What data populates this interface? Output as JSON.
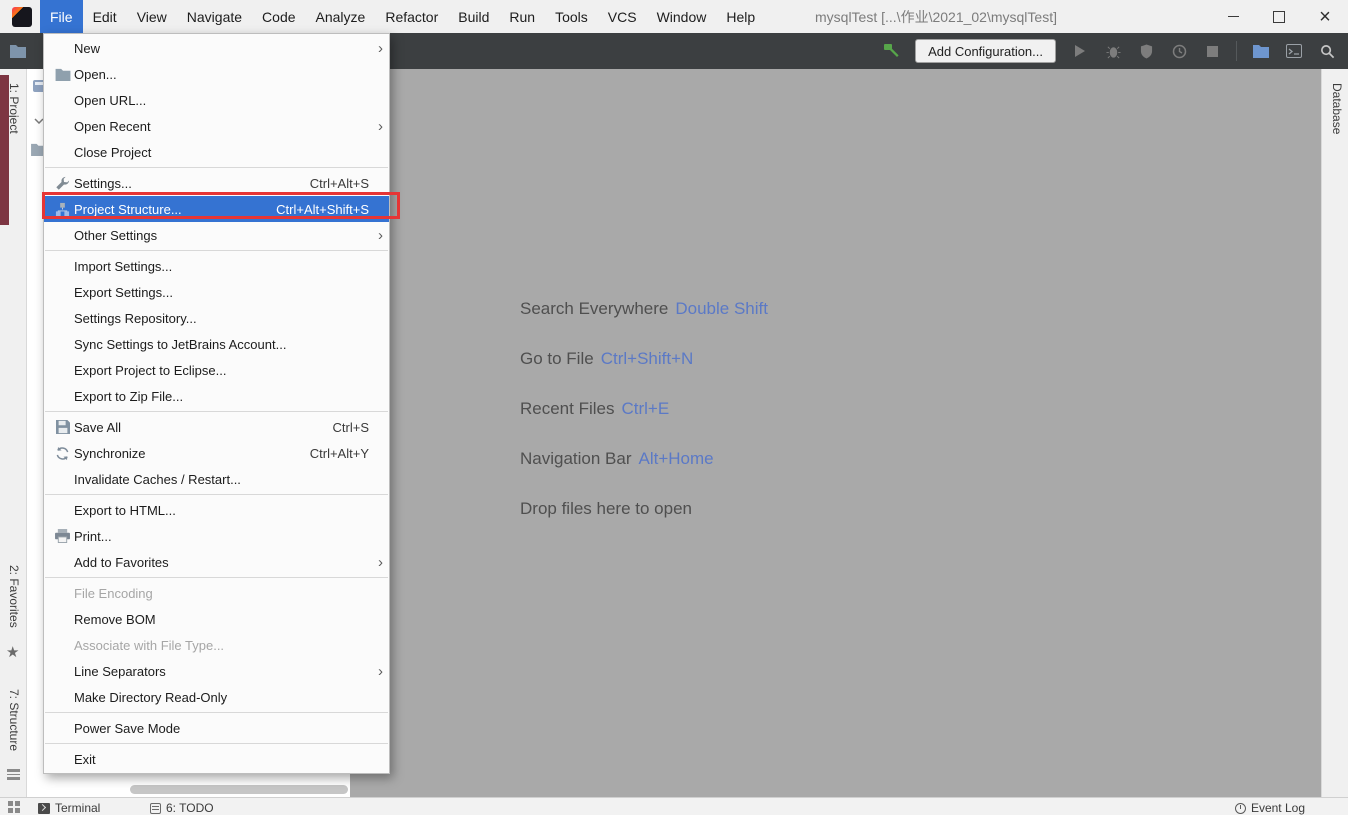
{
  "colors": {
    "titlebar-bg": "#f0f0f0",
    "toolbar-bg": "#3c3f41",
    "main-bg": "#a9a9a9",
    "menu-bg": "#fbfbfb",
    "stripe-bg": "#f0f0f0",
    "panel-bg": "#ffffff",
    "statusbar-bg": "#f2f2f2",
    "selection-blue": "#3573d2",
    "annotation-red": "#e63535",
    "hint-label": "#4f4f4f",
    "hint-shortcut": "#5b79c6",
    "maroon-accent": "#7d3542"
  },
  "titlebar": {
    "title": "mysqlTest [...\\作业\\2021_02\\mysqlTest]"
  },
  "menubar": {
    "items": [
      "File",
      "Edit",
      "View",
      "Navigate",
      "Code",
      "Analyze",
      "Refactor",
      "Build",
      "Run",
      "Tools",
      "VCS",
      "Window",
      "Help"
    ],
    "active": "File"
  },
  "toolbar": {
    "add_configuration_label": "Add Configuration..."
  },
  "stripes": {
    "left": [
      "1: Project",
      "2: Favorites",
      "7: Structure"
    ],
    "right": [
      "Database"
    ]
  },
  "hints": [
    {
      "label": "Search Everywhere",
      "shortcut": "Double Shift"
    },
    {
      "label": "Go to File",
      "shortcut": "Ctrl+Shift+N"
    },
    {
      "label": "Recent Files",
      "shortcut": "Ctrl+E"
    },
    {
      "label": "Navigation Bar",
      "shortcut": "Alt+Home"
    },
    {
      "label": "Drop files here to open",
      "shortcut": ""
    }
  ],
  "file_menu": {
    "items": [
      {
        "label": "New",
        "shortcut": "",
        "submenu": true
      },
      {
        "label": "Open...",
        "shortcut": ""
      },
      {
        "label": "Open URL...",
        "shortcut": ""
      },
      {
        "label": "Open Recent",
        "shortcut": "",
        "submenu": true
      },
      {
        "label": "Close Project",
        "shortcut": ""
      },
      {
        "label": "Settings...",
        "shortcut": "Ctrl+Alt+S"
      },
      {
        "label": "Project Structure...",
        "shortcut": "Ctrl+Alt+Shift+S",
        "selected": true
      },
      {
        "label": "Other Settings",
        "shortcut": "",
        "submenu": true
      },
      {
        "label": "Import Settings...",
        "shortcut": ""
      },
      {
        "label": "Export Settings...",
        "shortcut": ""
      },
      {
        "label": "Settings Repository...",
        "shortcut": ""
      },
      {
        "label": "Sync Settings to JetBrains Account...",
        "shortcut": ""
      },
      {
        "label": "Export Project to Eclipse...",
        "shortcut": ""
      },
      {
        "label": "Export to Zip File...",
        "shortcut": ""
      },
      {
        "label": "Save All",
        "shortcut": "Ctrl+S"
      },
      {
        "label": "Synchronize",
        "shortcut": "Ctrl+Alt+Y"
      },
      {
        "label": "Invalidate Caches / Restart...",
        "shortcut": ""
      },
      {
        "label": "Export to HTML...",
        "shortcut": ""
      },
      {
        "label": "Print...",
        "shortcut": ""
      },
      {
        "label": "Add to Favorites",
        "shortcut": "",
        "submenu": true
      },
      {
        "label": "File Encoding",
        "shortcut": "",
        "disabled": true
      },
      {
        "label": "Remove BOM",
        "shortcut": ""
      },
      {
        "label": "Associate with File Type...",
        "shortcut": "",
        "disabled": true
      },
      {
        "label": "Line Separators",
        "shortcut": "",
        "submenu": true
      },
      {
        "label": "Make Directory Read-Only",
        "shortcut": ""
      },
      {
        "label": "Power Save Mode",
        "shortcut": ""
      },
      {
        "label": "Exit",
        "shortcut": ""
      }
    ]
  },
  "statusbar": {
    "terminal_label": "Terminal",
    "todo_label": "6: TODO",
    "event_log_label": "Event Log"
  },
  "icons": {
    "titlebar": [
      "intellij-logo-icon",
      "minimize-icon",
      "maximize-icon",
      "close-icon"
    ],
    "toolbar": [
      "folder-icon",
      "hammer-icon",
      "run-icon",
      "debug-icon",
      "coverage-shield-icon",
      "profiler-clock-icon",
      "stop-icon",
      "open-project-icon",
      "terminal-window-icon",
      "search-icon"
    ],
    "file_menu": [
      "open-folder-icon",
      "settings-wrench-icon",
      "project-structure-icon",
      "save-all-icon",
      "synchronize-icon",
      "print-icon",
      "submenu-arrow-icon"
    ],
    "left_stripe": [
      "star-icon",
      "structure-icon"
    ],
    "statusbar": [
      "toolwindow-switcher-icon",
      "terminal-icon",
      "todo-icon",
      "event-log-icon"
    ]
  }
}
